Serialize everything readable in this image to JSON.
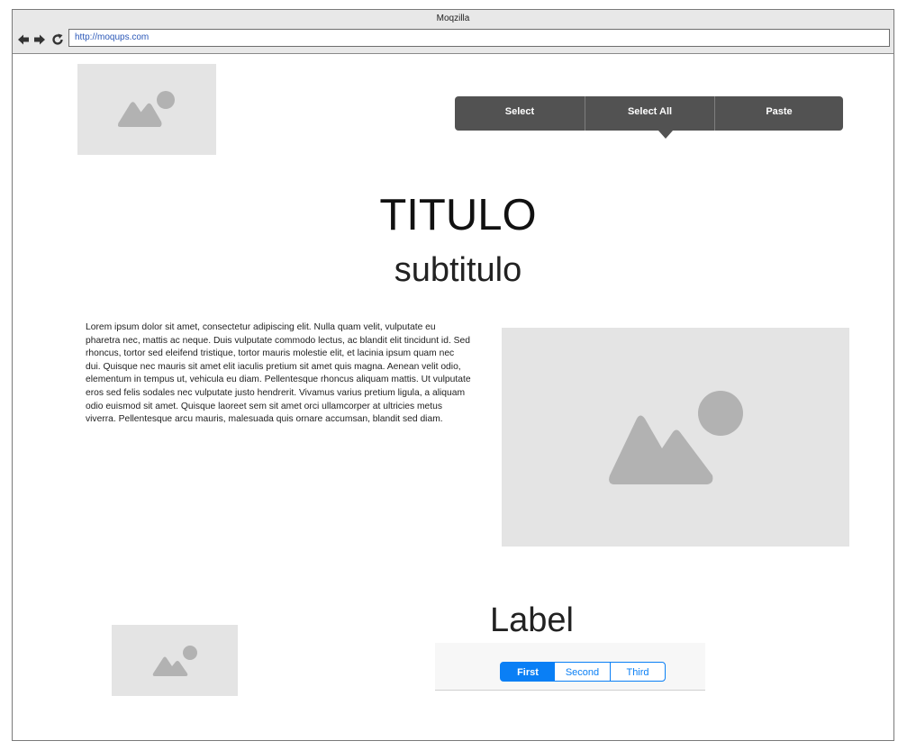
{
  "browser": {
    "title": "Moqzilla",
    "url": "http://moqups.com",
    "nav": {
      "back_icon": "arrow-left-icon",
      "forward_icon": "arrow-right-icon",
      "reload_icon": "reload-icon"
    }
  },
  "context_menu": {
    "items": [
      "Select",
      "Select All",
      "Paste"
    ]
  },
  "page": {
    "title": "TITULO",
    "subtitle": "subtitulo",
    "body_text": "Lorem ipsum dolor sit amet, consectetur adipiscing elit. Nulla quam velit, vulputate eu pharetra nec, mattis ac neque. Duis vulputate commodo lectus, ac blandit elit tincidunt id. Sed rhoncus, tortor sed eleifend tristique, tortor mauris molestie elit, et lacinia ipsum quam nec dui. Quisque nec mauris sit amet elit iaculis pretium sit amet quis magna. Aenean velit odio, elementum in tempus ut, vehicula eu diam. Pellentesque rhoncus aliquam mattis. Ut vulputate eros sed felis sodales nec vulputate justo hendrerit. Vivamus varius pretium ligula, a aliquam odio euismod sit amet. Quisque laoreet sem sit amet orci ullamcorper at ultricies metus viverra. Pellentesque arcu mauris, malesuada quis ornare accumsan, blandit sed diam.",
    "label": "Label"
  },
  "segmented_control": {
    "items": [
      "First",
      "Second",
      "Third"
    ],
    "selected": "First"
  },
  "colors": {
    "accent": "#0a7ff5",
    "menu_bg": "#525252",
    "placeholder_bg": "#e4e4e4",
    "placeholder_icon": "#b2b2b2"
  }
}
